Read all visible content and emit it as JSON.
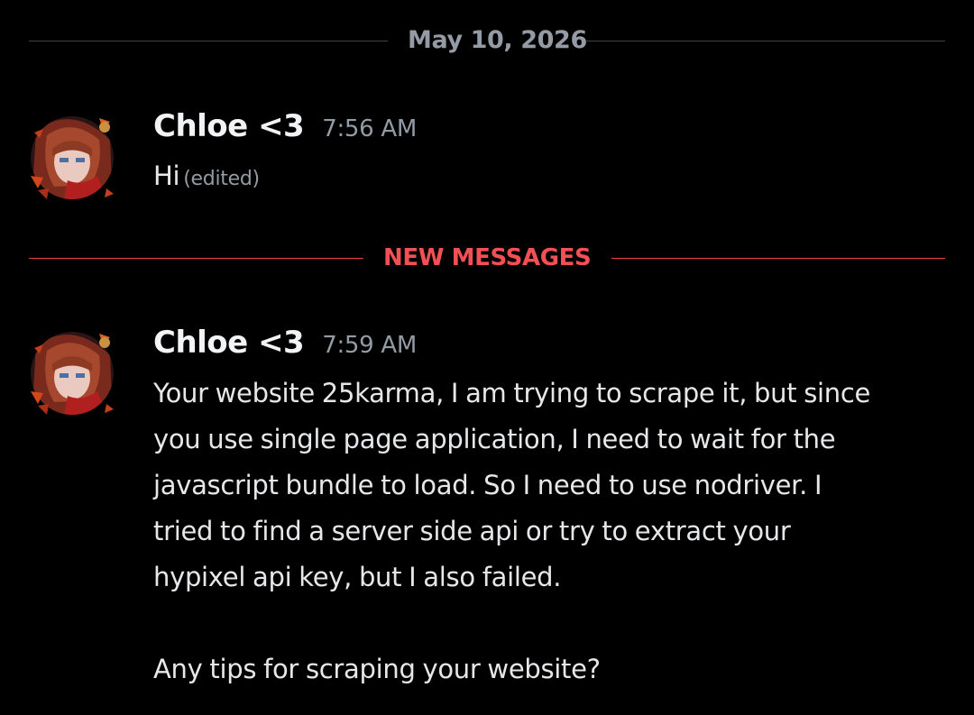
{
  "date_divider": {
    "label": "May 10, 2026"
  },
  "new_divider": {
    "label": "NEW MESSAGES"
  },
  "messages": [
    {
      "username": "Chloe <3",
      "timestamp": "7:56 AM",
      "text": "Hi",
      "edited": "(edited)",
      "avatar_icon": "user-avatar-icon"
    },
    {
      "username": "Chloe <3",
      "timestamp": "7:59 AM",
      "lines": [
        "Your website 25karma, I am trying to scrape it, but since",
        "you use single page application, I need to wait for the",
        "javascript bundle to load. So I need to use nodriver. I",
        "tried to find a server side api or try to extract your",
        "hypixel api key, but I also failed."
      ],
      "followup": "Any tips for scraping your website?",
      "avatar_icon": "user-avatar-icon"
    }
  ],
  "colors": {
    "background": "#000000",
    "divider": "#3f4147",
    "new_messages": "#f23f43",
    "username": "#f2f3f5",
    "timestamp": "#949ba4"
  }
}
